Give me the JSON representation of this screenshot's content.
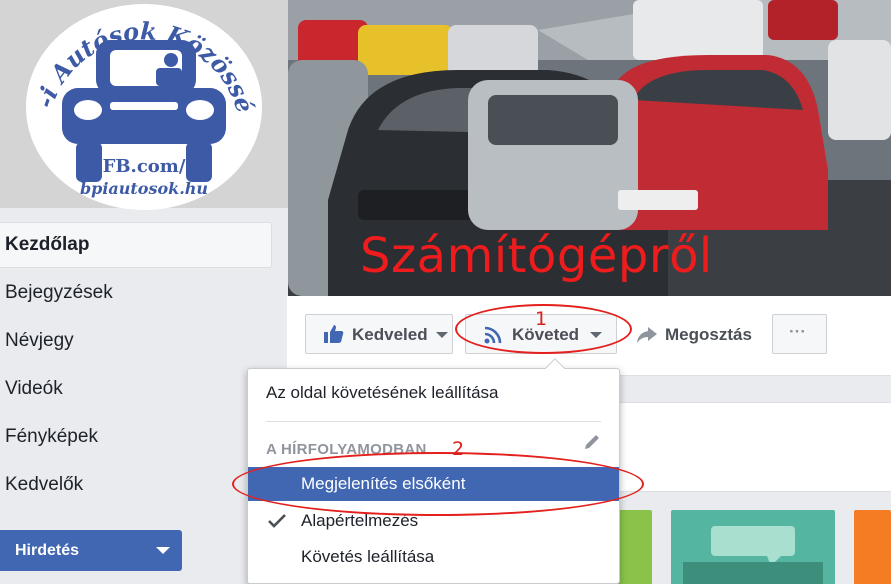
{
  "logo": {
    "arc_text": "Bp-i Autósok Közössége",
    "line1": "FB.com/",
    "line2": "bpiautosok.hu",
    "color": "#3d5aa6"
  },
  "sidebar": {
    "items": [
      {
        "label": "Kezdőlap",
        "active": true
      },
      {
        "label": "Bejegyzések"
      },
      {
        "label": "Névjegy"
      },
      {
        "label": "Videók"
      },
      {
        "label": "Fényképek"
      },
      {
        "label": "Kedvelők"
      }
    ],
    "ad_button": "Hirdetés"
  },
  "cover": {
    "overlay_text": "Számítógépről",
    "overlay_color": "#ee1c1c"
  },
  "actions": {
    "like": "Kedveled",
    "follow": "Követed",
    "share": "Megosztás",
    "more": "···"
  },
  "dropdown": {
    "unfollow_page": "Az oldal követésének leállítása",
    "section_header": "A HÍRFOLYAMODBAN",
    "options": [
      {
        "label": "Megjelenítés elsőként",
        "highlighted": true
      },
      {
        "label": "Alapértelmezés",
        "checked": true
      },
      {
        "label": "Követés leállítása"
      }
    ]
  },
  "annotations": {
    "n1": "1",
    "n2": "2",
    "color": "#e3201c"
  },
  "colors": {
    "brand": "#4267b2",
    "thumb_green": "#8bc34a",
    "thumb_teal": "#54b6a1",
    "thumb_orange": "#f57c22"
  }
}
